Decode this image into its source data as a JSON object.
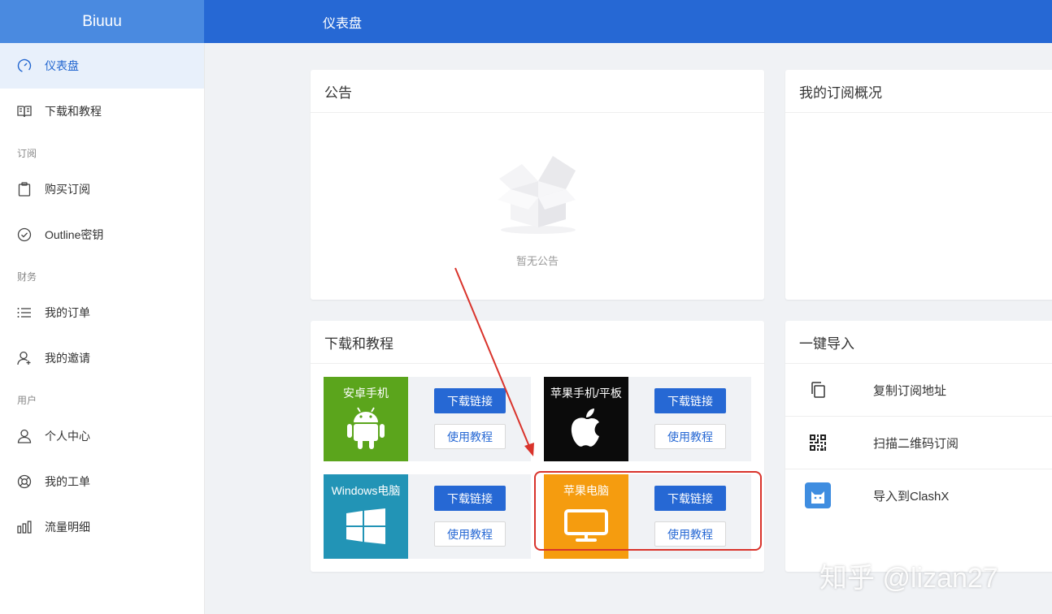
{
  "brand": "Biuuu",
  "header": {
    "title": "仪表盘"
  },
  "sidebar": {
    "items": [
      {
        "label": "仪表盘",
        "icon": "dashboard-icon",
        "active": true
      },
      {
        "label": "下载和教程",
        "icon": "book-icon"
      }
    ],
    "groups": [
      {
        "title": "订阅",
        "items": [
          {
            "label": "购买订阅",
            "icon": "clipboard-icon"
          },
          {
            "label": "Outline密钥",
            "icon": "check-circle-icon"
          }
        ]
      },
      {
        "title": "财务",
        "items": [
          {
            "label": "我的订单",
            "icon": "list-icon"
          },
          {
            "label": "我的邀请",
            "icon": "user-add-icon"
          }
        ]
      },
      {
        "title": "用户",
        "items": [
          {
            "label": "个人中心",
            "icon": "user-icon"
          },
          {
            "label": "我的工单",
            "icon": "lifebuoy-icon"
          },
          {
            "label": "流量明细",
            "icon": "bar-chart-icon"
          }
        ]
      }
    ]
  },
  "announcement": {
    "title": "公告",
    "empty_text": "暂无公告"
  },
  "subscription": {
    "title": "我的订阅概况"
  },
  "downloads": {
    "title": "下载和教程",
    "download_label": "下载链接",
    "tutorial_label": "使用教程",
    "platforms": [
      {
        "name": "安卓手机",
        "icon": "android-icon",
        "color": "#5ba51c"
      },
      {
        "name": "苹果手机/平板",
        "icon": "apple-icon",
        "color": "#0b0b0b"
      },
      {
        "name": "Windows电脑",
        "icon": "windows-icon",
        "color": "#2294b6"
      },
      {
        "name": "苹果电脑",
        "icon": "monitor-icon",
        "color": "#f59c0f"
      }
    ]
  },
  "one_click": {
    "title": "一键导入",
    "items": [
      {
        "label": "复制订阅地址",
        "icon": "copy-icon"
      },
      {
        "label": "扫描二维码订阅",
        "icon": "qrcode-icon"
      },
      {
        "label": "导入到ClashX",
        "icon": "clashx-icon"
      }
    ]
  },
  "annotation": {
    "color": "#d9332b"
  },
  "watermark": "知乎 @lizan27"
}
